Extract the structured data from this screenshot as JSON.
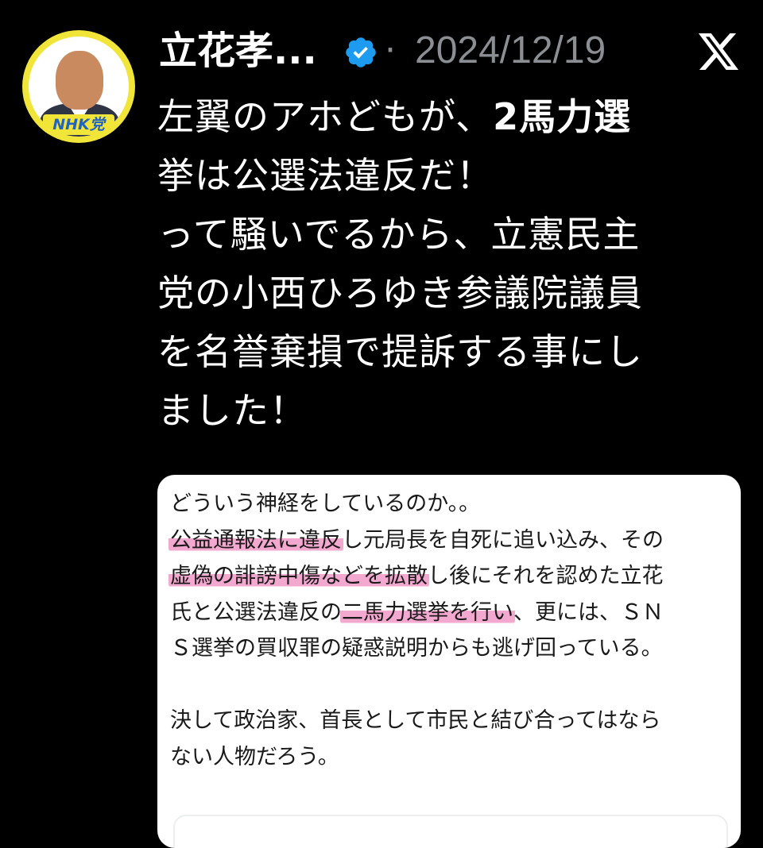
{
  "post": {
    "author_name": "立花孝...",
    "verified_icon": "verified-badge-icon",
    "separator": "·",
    "date": "2024/12/19",
    "platform_icon": "x-logo-icon",
    "avatar": {
      "badge_text": "NHK党",
      "ring_color": "#f2e53a",
      "badge_text_color": "#1f63c4"
    },
    "body_lines": [
      {
        "parts": [
          {
            "text": "左翼のアホどもが、",
            "bold": false
          },
          {
            "text": "2馬力選",
            "bold": true
          }
        ]
      },
      {
        "parts": [
          {
            "text": "挙は公選法違反だ！",
            "bold": false
          }
        ]
      },
      {
        "parts": [
          {
            "text": "って騒いでるから、立憲民主",
            "bold": false
          }
        ]
      },
      {
        "parts": [
          {
            "text": "党の小西ひろゆき参議院議員",
            "bold": false
          }
        ]
      },
      {
        "parts": [
          {
            "text": "を名誉棄損で提訴する事にし",
            "bold": false
          }
        ]
      },
      {
        "parts": [
          {
            "text": "ました！",
            "bold": false
          }
        ]
      }
    ]
  },
  "embedded_image": {
    "highlight_color": "#f3a8cf",
    "lines": [
      [
        {
          "text": "どういう神経をしているのか。。",
          "hl": false
        }
      ],
      [
        {
          "text": "公益通報法に違反",
          "hl": true
        },
        {
          "text": "し元局長を自死に追い込み、その",
          "hl": false
        }
      ],
      [
        {
          "text": "虚偽の誹謗中傷などを拡散",
          "hl": true
        },
        {
          "text": "し後にそれを認めた立花",
          "hl": false
        }
      ],
      [
        {
          "text": "氏と公選法違反の",
          "hl": false
        },
        {
          "text": "二馬力選挙を行い",
          "hl": true
        },
        {
          "text": "、更には、ＳＮ",
          "hl": false
        }
      ],
      [
        {
          "text": "Ｓ選挙の買収罪の疑惑説明からも逃げ回っている。",
          "hl": false
        }
      ],
      [],
      [
        {
          "text": "決して政治家、首長として市民と結び合ってはなら",
          "hl": false
        }
      ],
      [
        {
          "text": "ない人物だろう。",
          "hl": false
        }
      ]
    ]
  },
  "colors": {
    "background": "#000000",
    "text_primary": "#ffffff",
    "text_secondary": "#8b8f94",
    "verified_blue": "#1d9bf0"
  }
}
